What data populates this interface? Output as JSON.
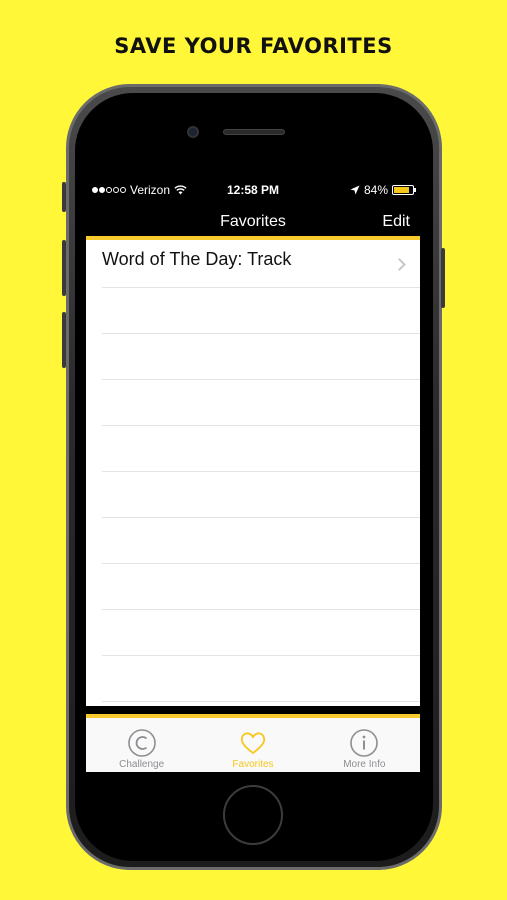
{
  "headline": "SAVE YOUR FAVORITES",
  "status_bar": {
    "carrier": "Verizon",
    "time": "12:58 PM",
    "battery": "84%",
    "battery_level": 0.84
  },
  "nav": {
    "title": "Favorites",
    "edit_label": "Edit"
  },
  "favorites": [
    {
      "label": "Word of The Day: Track"
    }
  ],
  "tabs": [
    {
      "label": "Challenge",
      "icon": "copyright-circle-icon",
      "active": false
    },
    {
      "label": "Favorites",
      "icon": "heart-icon",
      "active": true
    },
    {
      "label": "More Info",
      "icon": "info-circle-icon",
      "active": false
    }
  ],
  "colors": {
    "background": "#FFF737",
    "accent": "#F7C71A"
  }
}
